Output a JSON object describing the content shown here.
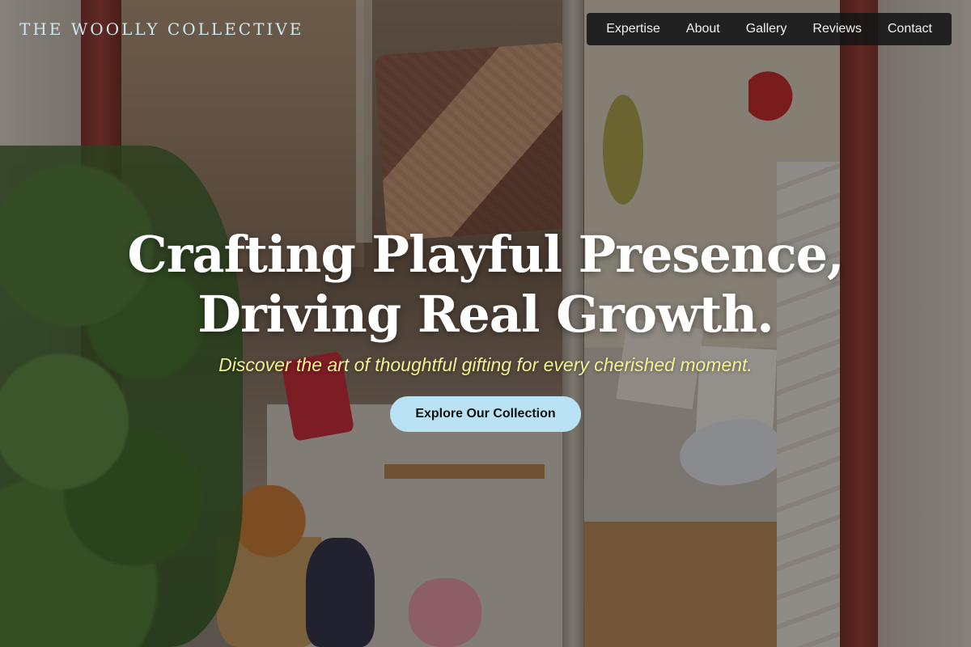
{
  "header": {
    "brand": "THE WOOLLY COLLECTIVE",
    "nav": [
      {
        "label": "Expertise"
      },
      {
        "label": "About"
      },
      {
        "label": "Gallery"
      },
      {
        "label": "Reviews"
      },
      {
        "label": "Contact"
      }
    ]
  },
  "hero": {
    "title_line1": "Crafting Playful Presence,",
    "title_line2": "Driving Real Growth.",
    "subtitle": "Discover the art of thoughtful gifting for every cherished moment.",
    "cta_label": "Explore Our Collection"
  },
  "colors": {
    "brand_text": "#cde7ee",
    "nav_bg": "#141416",
    "subtitle": "#f3ef93",
    "cta_bg": "#b9e3f4"
  }
}
